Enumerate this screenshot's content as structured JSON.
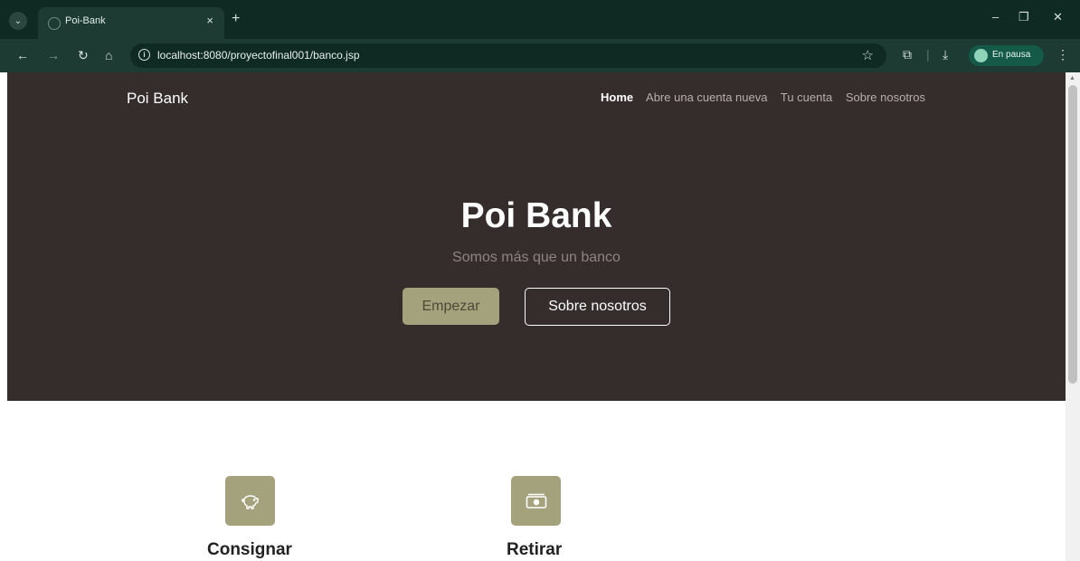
{
  "browser": {
    "tab_title": "Poi-Bank",
    "url": "localhost:8080/proyectofinal001/banco.jsp",
    "profile_label": "En pausa"
  },
  "page": {
    "brand": "Poi Bank",
    "nav": [
      {
        "label": "Home",
        "active": true
      },
      {
        "label": "Abre una cuenta nueva",
        "active": false
      },
      {
        "label": "Tu cuenta",
        "active": false
      },
      {
        "label": "Sobre nosotros",
        "active": false
      }
    ],
    "hero": {
      "title": "Poi Bank",
      "subtitle": "Somos más que un banco",
      "primary_button": "Empezar",
      "secondary_button": "Sobre nosotros"
    },
    "features": [
      {
        "title": "Consignar",
        "icon": "piggy-bank-icon"
      },
      {
        "title": "Retirar",
        "icon": "cash-icon"
      }
    ]
  },
  "colors": {
    "hero_bg": "#352c2c",
    "accent": "#a4a27c",
    "browser_frame": "#0f2923",
    "browser_toolbar": "#1d3b33"
  }
}
